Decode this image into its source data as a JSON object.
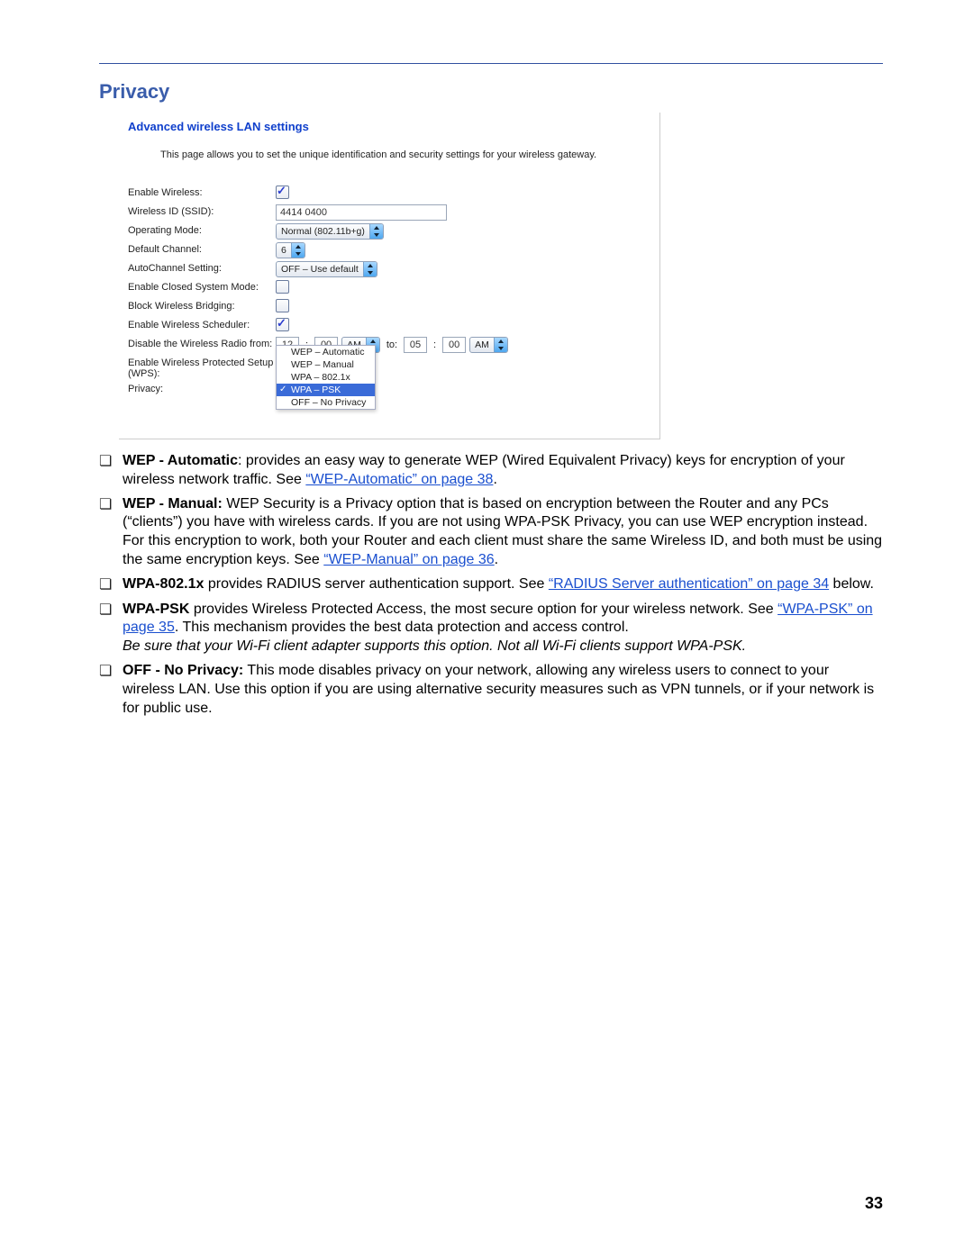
{
  "section_title": "Privacy",
  "panel": {
    "title": "Advanced wireless LAN settings",
    "description": "This page allows you to set the unique identification and security settings for your wireless gateway.",
    "rows": {
      "enable_wireless": {
        "label": "Enable Wireless:",
        "checked": true
      },
      "ssid": {
        "label": "Wireless ID (SSID):",
        "value": "4414 0400"
      },
      "operating_mode": {
        "label": "Operating Mode:",
        "value": "Normal (802.11b+g)"
      },
      "default_channel": {
        "label": "Default Channel:",
        "value": "6"
      },
      "autochannel": {
        "label": "AutoChannel Setting:",
        "value": "OFF – Use default"
      },
      "closed_system": {
        "label": "Enable Closed System Mode:",
        "checked": false
      },
      "block_bridging": {
        "label": "Block Wireless Bridging:",
        "checked": false
      },
      "scheduler": {
        "label": "Enable Wireless Scheduler:",
        "checked": true
      },
      "disable_radio": {
        "label": "Disable the Wireless Radio from:",
        "from_hh": "12",
        "from_mm": "00",
        "from_ampm": "AM",
        "to_label": "to:",
        "to_hh": "05",
        "to_mm": "00",
        "to_ampm": "AM"
      },
      "wps": {
        "label": "Enable Wireless Protected Setup (WPS):"
      },
      "privacy": {
        "label": "Privacy:",
        "options": [
          "WEP – Automatic",
          "WEP – Manual",
          "WPA – 802.1x",
          "WPA – PSK",
          "OFF – No Privacy"
        ],
        "selected_index": 3
      }
    }
  },
  "bullets": [
    {
      "bold": "WEP - Automatic",
      "sep": ": ",
      "body": "provides an easy way to generate WEP (Wired Equivalent Privacy) keys for encryption of your wireless network traffic. See ",
      "link": "“WEP-Automatic” on page 38",
      "tail": "."
    },
    {
      "bold": "WEP - Manual:",
      "sep": " ",
      "body": "WEP Security is a Privacy option that is based on encryption between the Router and any PCs (“clients”) you have with wireless cards. If you are not using WPA-PSK Privacy, you can use WEP encryption instead. For this encryption to work, both your Router and each client must share the same Wireless ID, and both must be using the same encryption keys. See ",
      "link": "“WEP-Manual” on page 36",
      "tail": "."
    },
    {
      "bold": "WPA-802.1x",
      "sep": " ",
      "body": "provides RADIUS server authentication support. See ",
      "link": "“RADIUS Server authentication” on page 34",
      "tail": " below."
    },
    {
      "bold": "WPA-PSK",
      "sep": " ",
      "body": "provides Wireless Protected Access, the most secure option for your wireless network. See ",
      "link": "“WPA-PSK” on page 35",
      "tail": ". This mechanism provides the best data protection and access control.",
      "italic_line": "Be sure that your Wi-Fi client adapter supports this option. Not all Wi-Fi clients support WPA-PSK."
    },
    {
      "bold": "OFF - No Privacy:",
      "sep": " ",
      "body": "This mode disables privacy on your network, allowing any wireless users to connect to your wireless LAN. Use this option if you are using alternative security measures such as VPN tunnels, or if your network is for public use.",
      "link": "",
      "tail": ""
    }
  ],
  "page_number": "33",
  "glyphs": {
    "bullet": "❏",
    "colon": ":"
  }
}
